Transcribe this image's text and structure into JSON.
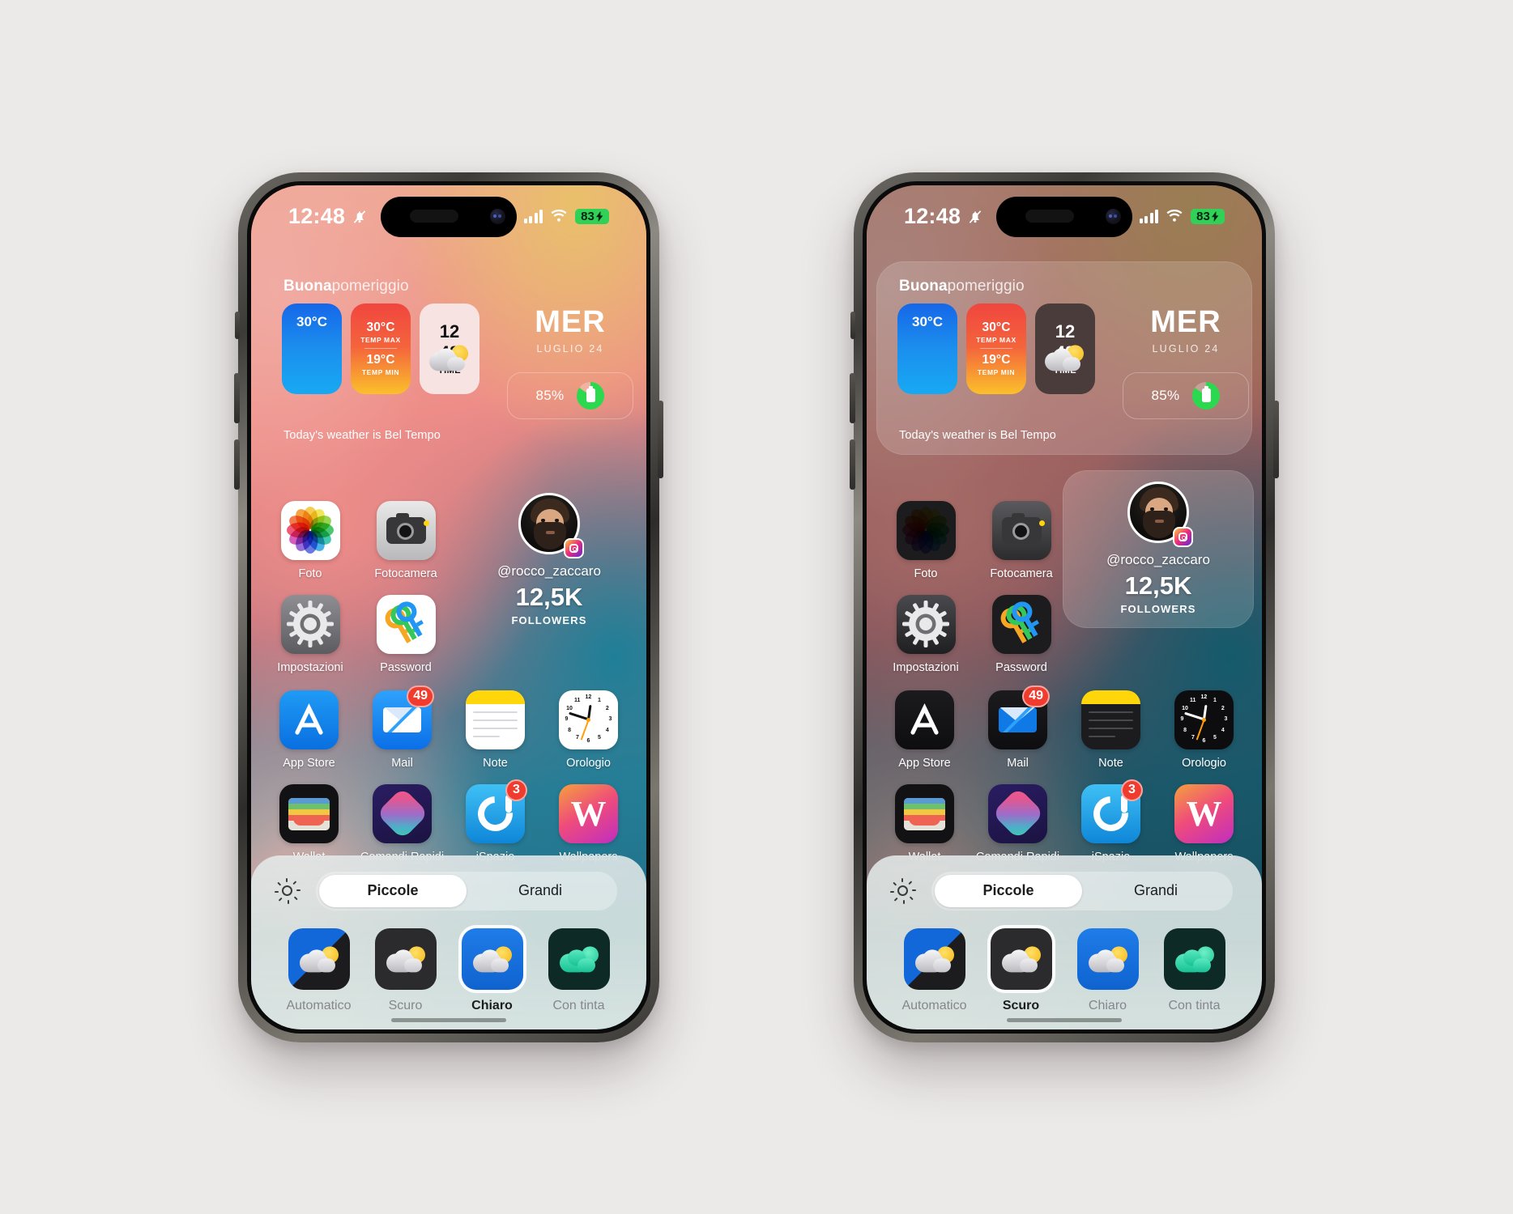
{
  "canvas": {
    "background": "#ece9e9"
  },
  "phones": [
    {
      "id": "phone-light",
      "theme": "light",
      "status": {
        "time": "12:48",
        "silent_icon": "bell-slash-icon",
        "signal_icon": "cellular-bars-icon",
        "wifi_icon": "wifi-icon",
        "battery_text": "83",
        "battery_color": "#31d158"
      },
      "widget": {
        "greeting_bold": "Buona",
        "greeting_rest": "pomeriggio",
        "weather_tile": {
          "condition_icon": "partly-cloudy-icon",
          "temp": "30°C"
        },
        "temps_tile": {
          "max_value": "30°C",
          "max_label": "TEMP MAX",
          "min_value": "19°C",
          "min_label": "TEMP MIN"
        },
        "time_tile": {
          "hours": "12",
          "minutes": "48",
          "label": "TIME",
          "style": "light"
        },
        "day_name": "MER",
        "day_date": "LUGLIO 24",
        "battery": {
          "percent_text": "85%",
          "ring_percent": 85,
          "ring_color": "#2bd94f",
          "icon": "battery-icon"
        },
        "note": "Today's weather is Bel Tempo",
        "selected": false
      },
      "apps": [
        [
          {
            "name": "Foto",
            "icon": "photos-icon",
            "badge": null
          },
          {
            "name": "Fotocamera",
            "icon": "camera-icon",
            "badge": null
          }
        ],
        [
          {
            "name": "Impostazioni",
            "icon": "settings-icon",
            "badge": null
          },
          {
            "name": "Password",
            "icon": "passwords-icon",
            "badge": null
          }
        ],
        [
          {
            "name": "App Store",
            "icon": "app-store-icon",
            "badge": null
          },
          {
            "name": "Mail",
            "icon": "mail-icon",
            "badge": "49"
          },
          {
            "name": "Note",
            "icon": "notes-icon",
            "badge": null
          },
          {
            "name": "Orologio",
            "icon": "clock-icon",
            "badge": null
          }
        ],
        [
          {
            "name": "Wallet",
            "icon": "wallet-icon",
            "badge": null
          },
          {
            "name": "Comandi Rapidi",
            "icon": "shortcuts-icon",
            "badge": null
          },
          {
            "name": "iSpazio",
            "icon": "ispazio-icon",
            "badge": "3"
          },
          {
            "name": "Wallpapers",
            "icon": "wallpapers-icon",
            "badge": null
          }
        ]
      ],
      "instagram": {
        "avatar_icon": "profile-avatar",
        "platform_icon": "instagram-icon",
        "handle": "@rocco_zaccaro",
        "count": "12,5K",
        "label": "FOLLOWERS",
        "selected": false
      },
      "panel": {
        "brightness_icon": "brightness-icon",
        "segments": [
          {
            "label": "Piccole",
            "selected": true
          },
          {
            "label": "Grandi",
            "selected": false
          }
        ],
        "modes": [
          {
            "label": "Automatico",
            "style": "auto",
            "selected": false
          },
          {
            "label": "Scuro",
            "style": "dark",
            "selected": false
          },
          {
            "label": "Chiaro",
            "style": "light",
            "selected": true
          },
          {
            "label": "Con tinta",
            "style": "tint",
            "selected": false
          }
        ]
      }
    },
    {
      "id": "phone-dark",
      "theme": "dark",
      "status": {
        "time": "12:48",
        "silent_icon": "bell-slash-icon",
        "signal_icon": "cellular-bars-icon",
        "wifi_icon": "wifi-icon",
        "battery_text": "83",
        "battery_color": "#31d158"
      },
      "widget": {
        "greeting_bold": "Buona",
        "greeting_rest": "pomeriggio",
        "weather_tile": {
          "condition_icon": "partly-cloudy-icon",
          "temp": "30°C"
        },
        "temps_tile": {
          "max_value": "30°C",
          "max_label": "TEMP MAX",
          "min_value": "19°C",
          "min_label": "TEMP MIN"
        },
        "time_tile": {
          "hours": "12",
          "minutes": "48",
          "label": "TIME",
          "style": "dark"
        },
        "day_name": "MER",
        "day_date": "LUGLIO 24",
        "battery": {
          "percent_text": "85%",
          "ring_percent": 85,
          "ring_color": "#2bd94f",
          "icon": "battery-icon"
        },
        "note": "Today's weather is Bel Tempo",
        "selected": true
      },
      "apps": [
        [
          {
            "name": "Foto",
            "icon": "photos-icon",
            "badge": null
          },
          {
            "name": "Fotocamera",
            "icon": "camera-icon",
            "badge": null
          }
        ],
        [
          {
            "name": "Impostazioni",
            "icon": "settings-icon",
            "badge": null
          },
          {
            "name": "Password",
            "icon": "passwords-icon",
            "badge": null
          }
        ],
        [
          {
            "name": "App Store",
            "icon": "app-store-icon",
            "badge": null
          },
          {
            "name": "Mail",
            "icon": "mail-icon",
            "badge": "49"
          },
          {
            "name": "Note",
            "icon": "notes-icon",
            "badge": null
          },
          {
            "name": "Orologio",
            "icon": "clock-icon",
            "badge": null
          }
        ],
        [
          {
            "name": "Wallet",
            "icon": "wallet-icon",
            "badge": null
          },
          {
            "name": "Comandi Rapidi",
            "icon": "shortcuts-icon",
            "badge": null
          },
          {
            "name": "iSpazio",
            "icon": "ispazio-icon",
            "badge": "3"
          },
          {
            "name": "Wallpapers",
            "icon": "wallpapers-icon",
            "badge": null
          }
        ]
      ],
      "instagram": {
        "avatar_icon": "profile-avatar",
        "platform_icon": "instagram-icon",
        "handle": "@rocco_zaccaro",
        "count": "12,5K",
        "label": "FOLLOWERS",
        "selected": true
      },
      "panel": {
        "brightness_icon": "brightness-icon",
        "segments": [
          {
            "label": "Piccole",
            "selected": true
          },
          {
            "label": "Grandi",
            "selected": false
          }
        ],
        "modes": [
          {
            "label": "Automatico",
            "style": "auto",
            "selected": false
          },
          {
            "label": "Scuro",
            "style": "dark",
            "selected": true
          },
          {
            "label": "Chiaro",
            "style": "light",
            "selected": false
          },
          {
            "label": "Con tinta",
            "style": "tint",
            "selected": false
          }
        ]
      }
    }
  ]
}
